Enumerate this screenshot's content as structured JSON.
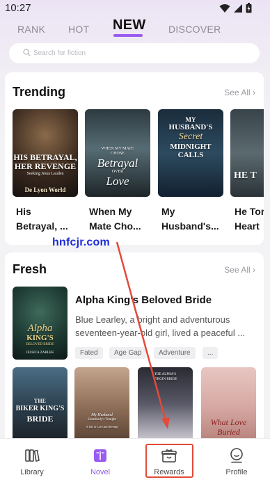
{
  "status_bar": {
    "time": "10:27"
  },
  "top_tabs": [
    {
      "label": "RANK",
      "active": false
    },
    {
      "label": "HOT",
      "active": false
    },
    {
      "label": "NEW",
      "active": true
    },
    {
      "label": "DISCOVER",
      "active": false
    }
  ],
  "search": {
    "placeholder": "Search for fiction"
  },
  "trending": {
    "title": "Trending",
    "see_all": "See All",
    "books": [
      {
        "title_line1": "His",
        "title_line2": "Betrayal, ...",
        "cover_line1": "HIS BETRAYAL,",
        "cover_line2": "HER REVENGE",
        "cover_line3": "Seeking Jesus Lauden",
        "cover_author": "De Lyon World"
      },
      {
        "title_line1": "When My",
        "title_line2": "Mate Cho...",
        "cover_line1": "WHEN MY MATE",
        "cover_line2": "CHOSE",
        "cover_line3": "Betrayal",
        "cover_line4": "OVER",
        "cover_line5": "Love"
      },
      {
        "title_line1": "My",
        "title_line2": "Husband's...",
        "cover_line1": "MY",
        "cover_line2": "HUSBAND'S",
        "cover_line3": "Secret",
        "cover_line4": "MIDNIGHT",
        "cover_line5": "CALLS"
      },
      {
        "title_line1": "He Tor",
        "title_line2": "Heart",
        "cover_line1": "HE T"
      }
    ]
  },
  "watermark": "hnfcjr.com",
  "fresh": {
    "title": "Fresh",
    "see_all": "See All",
    "featured": {
      "title": "Alpha King's Beloved Bride",
      "description_line1": "Blue Learley, a bright and adventurous",
      "description_line2": "seventeen-year-old girl, lived a peaceful ...",
      "tags": [
        "Fated",
        "Age Gap",
        "Adventure",
        "..."
      ],
      "cover_line1": "Alpha",
      "cover_line2": "KING'S",
      "cover_line3": "BELOVED BRIDE",
      "cover_author": "JESSICA ZABLEK"
    },
    "covers": [
      {
        "line1": "THE",
        "line2": "BIKER KING'S",
        "line3": "BRIDE"
      },
      {
        "line1": "My Husband",
        "line2": "Somebody's Tonight",
        "line3": "A Tale of Love and Revenge"
      },
      {
        "line1": "THE ALPHA'S",
        "line2": "VIRGIN BRIDE"
      },
      {
        "line1": "What Love",
        "line2": "Buried"
      }
    ]
  },
  "bottom_nav": [
    {
      "label": "Library",
      "active": false
    },
    {
      "label": "Novel",
      "active": true
    },
    {
      "label": "Rewards",
      "active": false
    },
    {
      "label": "Profile",
      "active": false
    }
  ],
  "colors": {
    "accent": "#8f5ae8",
    "highlight": "#e24a3b",
    "watermark": "#1b2ad8"
  }
}
